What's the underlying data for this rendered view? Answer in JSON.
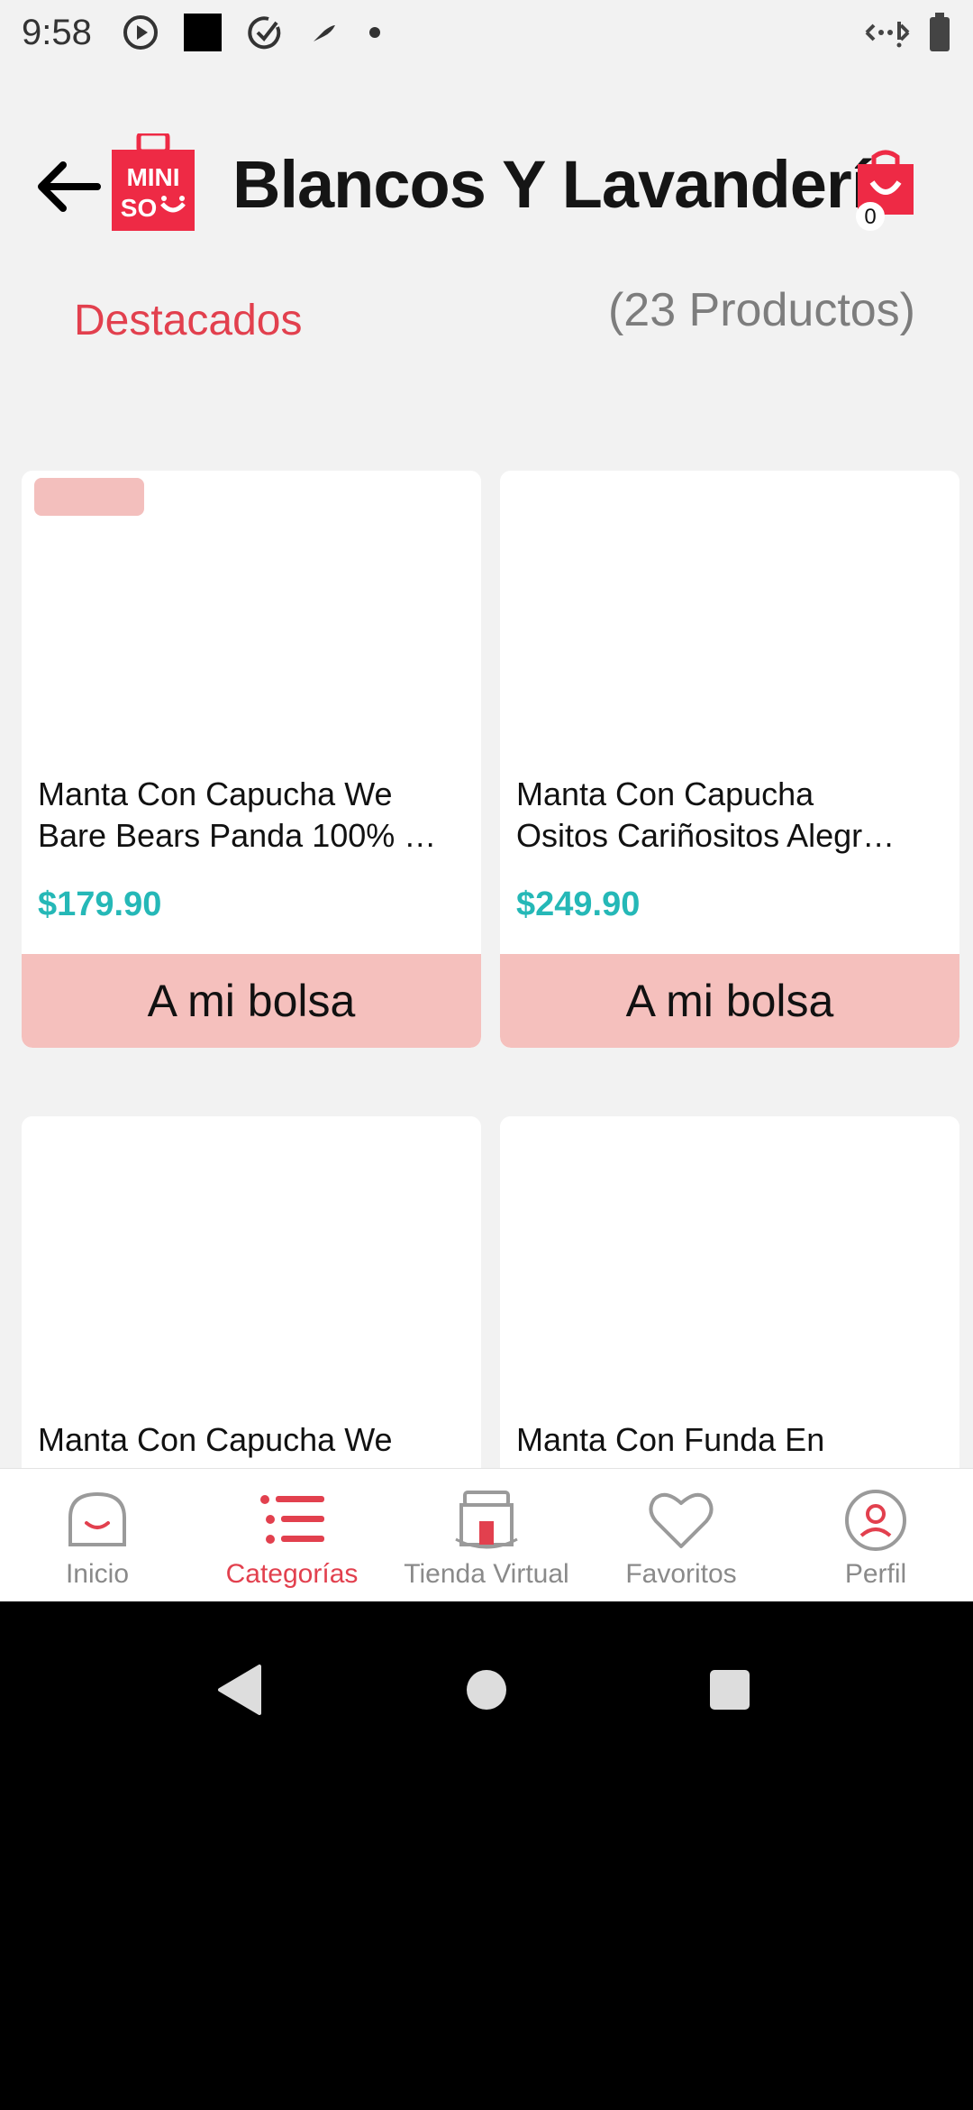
{
  "status_bar": {
    "time": "9:58"
  },
  "header": {
    "title": "Blancos Y Lavandería",
    "cart_count": "0"
  },
  "sort": {
    "label": "Destacados",
    "count": "(23 Productos)"
  },
  "products": [
    {
      "name_line1": "Manta Con Capucha We",
      "name_line2": "Bare Bears Panda 100% …",
      "price": "$179.90",
      "button": "A mi bolsa"
    },
    {
      "name_line1": "Manta Con Capucha",
      "name_line2": "Ositos Cariñositos Alegr…",
      "price": "$249.90",
      "button": "A mi bolsa"
    },
    {
      "name_line1": "Manta Con Capucha We",
      "name_line2": "",
      "price": "",
      "button": ""
    },
    {
      "name_line1": "Manta Con Funda En",
      "name_line2": "",
      "price": "",
      "button": ""
    }
  ],
  "bottom_nav": [
    {
      "label": "Inicio",
      "icon": "home-icon"
    },
    {
      "label": "Categorías",
      "icon": "categories-icon"
    },
    {
      "label": "Tienda Virtual",
      "icon": "store-icon"
    },
    {
      "label": "Favoritos",
      "icon": "heart-icon"
    },
    {
      "label": "Perfil",
      "icon": "profile-icon"
    }
  ],
  "colors": {
    "accent": "#e2404e",
    "price": "#25b8b7",
    "button_bg": "#f5c0bd",
    "logo_red": "#ee2a45"
  }
}
